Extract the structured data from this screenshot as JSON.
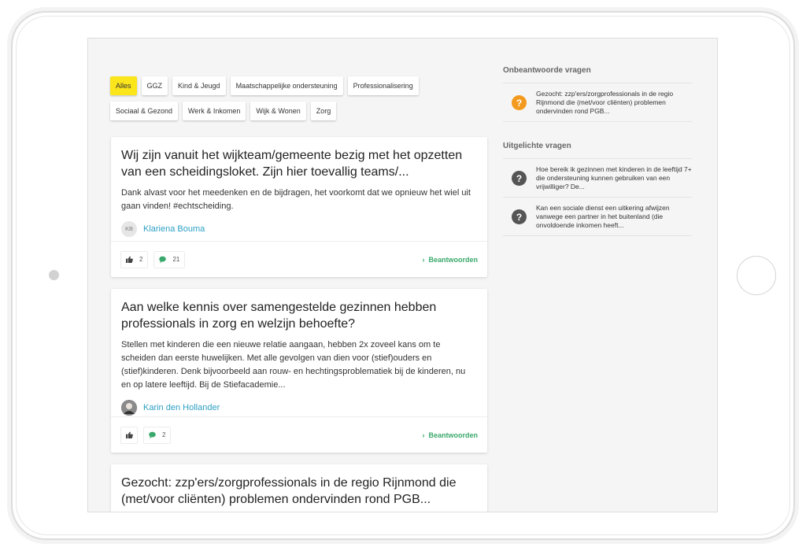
{
  "filters": [
    {
      "label": "Alles",
      "active": true
    },
    {
      "label": "GGZ",
      "active": false
    },
    {
      "label": "Kind & Jeugd",
      "active": false
    },
    {
      "label": "Maatschappelijke ondersteuning",
      "active": false
    },
    {
      "label": "Professionalisering",
      "active": false
    },
    {
      "label": "Sociaal & Gezond",
      "active": false
    },
    {
      "label": "Werk & Inkomen",
      "active": false
    },
    {
      "label": "Wijk & Wonen",
      "active": false
    },
    {
      "label": "Zorg",
      "active": false
    }
  ],
  "questions": [
    {
      "title": "Wij zijn vanuit het wijkteam/gemeente bezig met het opzetten van een scheidingsloket. Zijn hier toevallig teams/...",
      "text": "Dank alvast voor het meedenken en de bijdragen, het voorkomt dat we opnieuw het wiel uit gaan vinden! #echtscheiding.",
      "author_initials": "KB",
      "author": "Klariena Bouma",
      "likes": "2",
      "comments": "21",
      "answer_label": "Beantwoorden"
    },
    {
      "title": "Aan welke kennis over samengestelde gezinnen hebben professionals in zorg en welzijn behoefte?",
      "text": "Stellen met kinderen die een nieuwe relatie aangaan, hebben 2x zoveel kans om te scheiden dan eerste huwelijken. Met alle gevolgen van dien voor (stief)ouders en (stief)kinderen. Denk bijvoorbeeld aan rouw- en hechtingsproblematiek bij de kinderen, nu en op latere leeftijd. Bij de Stiefacademie...",
      "author": "Karin den Hollander",
      "comments": "2",
      "answer_label": "Beantwoorden"
    },
    {
      "title": "Gezocht: zzp'ers/zorgprofessionals in de regio Rijnmond die (met/voor cliënten) problemen ondervinden rond PGB..."
    }
  ],
  "sidebar": {
    "unanswered_heading": "Onbeantwoorde vragen",
    "unanswered": [
      {
        "text": "Gezocht: zzp'ers/zorgprofessionals in de regio Rijnmond die (met/voor cliënten) problemen ondervinden rond PGB...",
        "icon": "question-icon",
        "color": "#f39a1e"
      }
    ],
    "featured_heading": "Uitgelichte vragen",
    "featured": [
      {
        "text": "Hoe bereik ik gezinnen met kinderen in de leeftijd 7+ die ondersteuning kunnen gebruiken van een vrijwilliger? De...",
        "icon": "question-icon",
        "color": "#555555"
      },
      {
        "text": "Kan een sociale dienst een uitkering afwijzen vanwege een partner in het buitenland (die onvoldoende inkomen heeft...",
        "icon": "question-icon",
        "color": "#555555"
      }
    ]
  },
  "colors": {
    "accent": "#fbe51b",
    "link": "#2ca0c4",
    "answer": "#3aa86c"
  }
}
